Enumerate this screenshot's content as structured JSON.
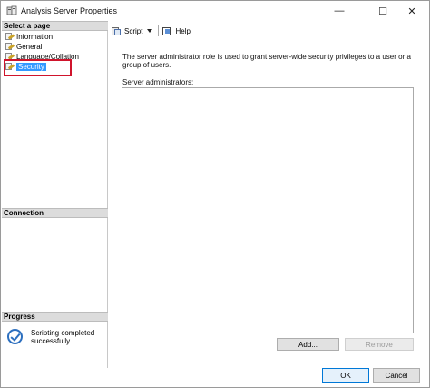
{
  "window": {
    "title": "Analysis Server Properties",
    "minimize_glyph": "—",
    "maximize_glyph": "☐",
    "close_glyph": "✕"
  },
  "left_pane": {
    "select_page_header": "Select a page",
    "pages": [
      {
        "label": "Information"
      },
      {
        "label": "General"
      },
      {
        "label": "Language/Collation"
      },
      {
        "label": "Security",
        "selected": true
      }
    ],
    "connection_header": "Connection",
    "progress_header": "Progress",
    "progress_status": "Scripting completed successfully."
  },
  "toolbar": {
    "script_label": "Script",
    "help_label": "Help"
  },
  "main": {
    "description": "The server administrator role is used to grant server-wide security privileges to a user or a group of users.",
    "admins_label": "Server administrators:",
    "add_button": "Add...",
    "remove_button": "Remove"
  },
  "footer": {
    "ok_button": "OK",
    "cancel_button": "Cancel"
  },
  "colors": {
    "selection": "#3399ff",
    "highlight_box": "#d0142c",
    "ok_border": "#0078d7"
  }
}
